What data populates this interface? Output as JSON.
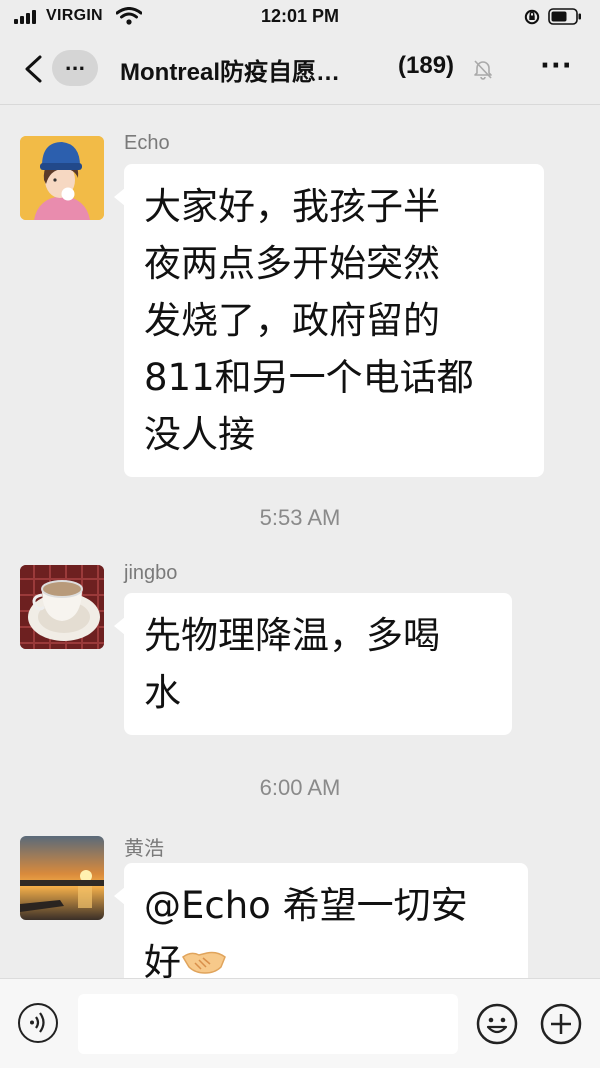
{
  "status_bar": {
    "carrier": "VIRGIN",
    "time": "12:01 PM"
  },
  "nav": {
    "more_label": "...",
    "title": "Montreal防疫自愿…",
    "member_count": "(189)",
    "options_label": "···"
  },
  "messages": [
    {
      "sender": "Echo",
      "lines": [
        "大家好，我孩子半",
        "夜两点多开始突然",
        "发烧了，政府留的",
        "811和另一个电话都",
        "没人接"
      ]
    },
    {
      "timestamp": "5:53 AM"
    },
    {
      "sender": "jingbo",
      "lines": [
        "先物理降温，多喝",
        "水"
      ]
    },
    {
      "timestamp": "6:00 AM"
    },
    {
      "sender": "黄浩",
      "lines": [
        "@Echo 希望一切安",
        "好"
      ],
      "trailing_emoji": "handshake"
    }
  ],
  "input": {
    "placeholder": ""
  },
  "colors": {
    "background": "#ededed",
    "bubble": "#ffffff",
    "meta_text": "#8a8a8a"
  }
}
